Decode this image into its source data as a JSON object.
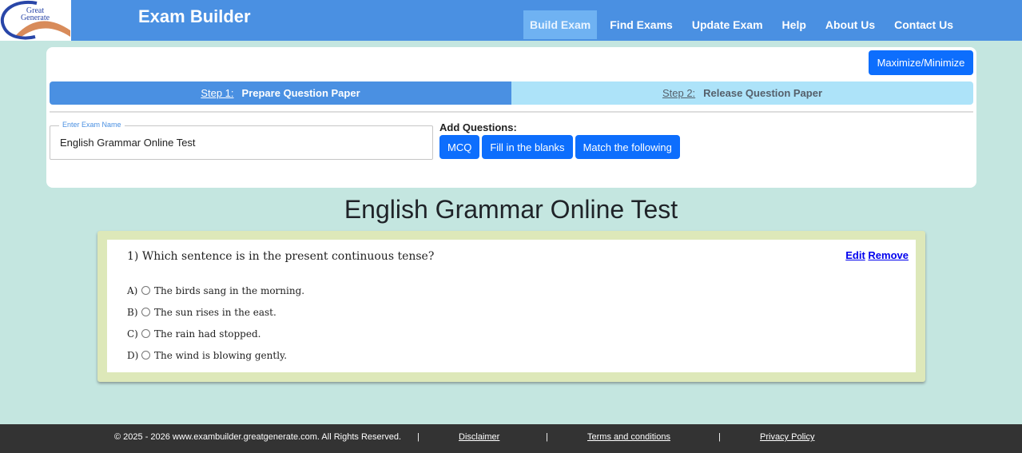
{
  "header": {
    "logo_text": [
      "Great",
      "Generate"
    ],
    "title": "Exam Builder",
    "nav": [
      "Build Exam",
      "Find Exams",
      "Update Exam",
      "Help",
      "About Us",
      "Contact Us"
    ],
    "active_nav": "Build Exam",
    "colors": {
      "bar": "#4a90e2",
      "active_tab": "#6fb2f2"
    }
  },
  "builder": {
    "maximize_label": "Maximize/Minimize",
    "steps": [
      {
        "num": "Step 1:",
        "label": "Prepare Question Paper",
        "active": true
      },
      {
        "num": "Step 2:",
        "label": "Release Question Paper",
        "active": false
      }
    ],
    "exam_name_label": "Enter Exam Name",
    "exam_name_value": "English Grammar Online Test",
    "add_questions_label": "Add Questions:",
    "add_buttons": [
      "MCQ",
      "Fill in the blanks",
      "Match the following"
    ],
    "colors": {
      "primary_button": "#0d6efd",
      "step_active": "#4a90e2",
      "step_inactive": "#ade3f9"
    }
  },
  "exam": {
    "title": "English Grammar Online Test",
    "questions": [
      {
        "number": "1)",
        "text": "Which sentence is in the present continuous tense?",
        "edit_label": "Edit",
        "remove_label": "Remove",
        "options": [
          {
            "letter": "A)",
            "text": "The birds sang in the morning."
          },
          {
            "letter": "B)",
            "text": "The sun rises in the east."
          },
          {
            "letter": "C)",
            "text": "The rain had stopped."
          },
          {
            "letter": "D)",
            "text": "The wind is blowing gently."
          }
        ]
      }
    ]
  },
  "footer": {
    "copyright": "© 2025 - 2026 www.exambuilder.greatgenerate.com. All Rights Reserved.",
    "separator": "|",
    "links": [
      "Disclaimer",
      "Terms and conditions",
      "Privacy Policy"
    ]
  }
}
